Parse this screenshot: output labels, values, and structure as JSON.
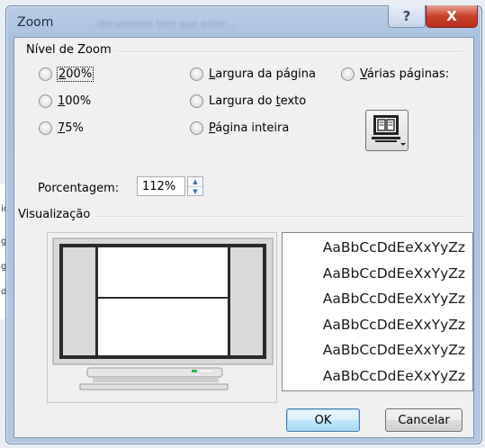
{
  "window": {
    "title": "Zoom",
    "background_text": "…documento tem que estar…",
    "help_label": "?",
    "close_label": "X"
  },
  "zoom_group": {
    "label": "Nível de Zoom",
    "options": [
      {
        "label": "200%",
        "mnemonic": "2",
        "selected": false
      },
      {
        "label": "100%",
        "mnemonic": "1",
        "selected": false
      },
      {
        "label": "75%",
        "mnemonic": "7",
        "selected": false
      },
      {
        "label": "Largura da página",
        "mnemonic": "L",
        "selected": false
      },
      {
        "label": "Largura do texto",
        "mnemonic": "t",
        "selected": false
      },
      {
        "label": "Página inteira",
        "mnemonic": "P",
        "selected": false
      },
      {
        "label": "Várias páginas:",
        "mnemonic": "V",
        "selected": false
      }
    ],
    "multi_page_icon": "monitor-pages-icon"
  },
  "percentage": {
    "label": "Porcentagem:",
    "value": "112%"
  },
  "preview": {
    "label": "Visualização",
    "sample_text": [
      "AaBbCcDdEeXxYyZz",
      "AaBbCcDdEeXxYyZz",
      "AaBbCcDdEeXxYyZz",
      "AaBbCcDdEeXxYyZz",
      "AaBbCcDdEeXxYyZz",
      "AaBbCcDdEeXxYyZz"
    ]
  },
  "buttons": {
    "ok": "OK",
    "cancel": "Cancelar"
  },
  "background_doc": [
    "ic",
    "gi",
    "g",
    "d"
  ],
  "colors": {
    "frame": "#a8c1e0",
    "close": "#c9412b",
    "default_button_border": "#3c7fb1"
  }
}
